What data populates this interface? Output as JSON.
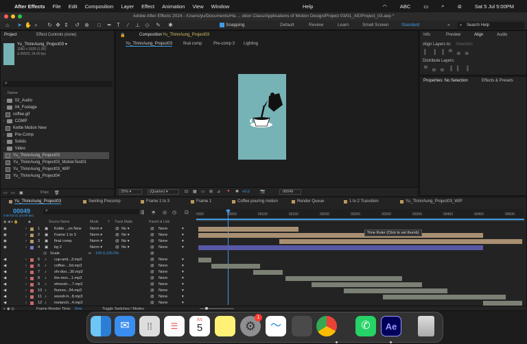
{
  "menubar": {
    "app": "After Effects",
    "items": [
      "File",
      "Edit",
      "Composition",
      "Layer",
      "Effect",
      "Animation",
      "View",
      "Window"
    ],
    "help": "Help",
    "input_source": "ABC",
    "datetime": "Sat 5 Jul  5:00PM"
  },
  "window_title": "Adobe After Effects 2024 - /Users/yu/Documents/Ha ... otion Class/Applications of Motion Design/Project 03/01_AE/Project_03.aep *",
  "toolbar": {
    "snapping": "Snapping",
    "workspaces": [
      "Default",
      "Review",
      "Learn",
      "Small Screen",
      "Standard"
    ],
    "active_workspace": "Standard",
    "search_placeholder": "Search Help"
  },
  "project_panel": {
    "tab_project": "Project",
    "tab_effect_controls": "Effect Controls (none)",
    "comp_name": "Yu_ThinnAung_Project03 ▾",
    "comp_res": "1080 x 1920 (1.00)",
    "comp_dur": "Δ 00520, 24.00 fps",
    "search_icon": "search-icon",
    "col_name": "Name",
    "items": [
      {
        "name": "02_Audio",
        "type": "folder"
      },
      {
        "name": "04_Footage",
        "type": "folder"
      },
      {
        "name": "coffee.gif",
        "type": "file"
      },
      {
        "name": "COMP",
        "type": "folder"
      },
      {
        "name": "Kettle Motion New",
        "type": "comp"
      },
      {
        "name": "Pre-Comp",
        "type": "folder"
      },
      {
        "name": "Solids",
        "type": "folder"
      },
      {
        "name": "Video",
        "type": "folder"
      },
      {
        "name": "Yu_ThinnAung_Project03",
        "type": "comp",
        "selected": true
      },
      {
        "name": "Yu_ThinnAung_Project03_MotionTest01",
        "type": "comp"
      },
      {
        "name": "Yu_ThinnAung_Project03_WIP",
        "type": "comp"
      },
      {
        "name": "Yu_ThinnAung_Project04",
        "type": "comp"
      }
    ],
    "bpc": "8 bpc"
  },
  "comp_panel": {
    "label": "Composition",
    "comp_name": "Yu_ThinnAung_Project03",
    "breadcrumb": [
      "Yu_ThinnAung_Project03",
      "final comp",
      "Pre-comp 3",
      "Lighting"
    ],
    "zoom": "25%",
    "resolution": "(Quarter)",
    "exposure": "+0.0",
    "timecode": "00049",
    "canvas_color": "#76b3b7"
  },
  "right_panel": {
    "tabs": [
      "Info",
      "Preview",
      "Align",
      "Audio"
    ],
    "active": "Align",
    "align_to_label": "Align Layers to:",
    "align_to_value": "Selection",
    "distribute_label": "Distribute Layers:",
    "props_tab": "Properties: No Selection",
    "effects_tab": "Effects & Presets"
  },
  "timeline": {
    "tabs": [
      "Yu_ThinnAung_Project03",
      "Swirling Precomp",
      "Frame 1 to 3",
      "Frame 1",
      "Coffee pouring motion",
      "Render Queue",
      "1 to 2 Transition",
      "Yu_ThinnAung_Project03_WIP"
    ],
    "timecode": "00049",
    "timecode_sub": "0:00:02:01 (24.00 fps)",
    "columns": {
      "source": "Source Name",
      "mode": "Mode",
      "t": "T",
      "trkmat": "Track Matte",
      "parent": "Parent & Link"
    },
    "ruler": [
      "0000",
      "00050",
      "00100",
      "00150",
      "00200",
      "00250",
      "00300",
      "00350",
      "00400",
      "00450",
      "00500"
    ],
    "tooltip": "Time Ruler (Click to set thumb)",
    "layers": [
      {
        "num": "1",
        "name": "Kettle ...on New",
        "mode": "Norm",
        "matte": "No",
        "parent": "None",
        "bar_start": 0,
        "bar_end": 0.31,
        "color": "#a98f72"
      },
      {
        "num": "2",
        "name": "Frame 1 to 3",
        "mode": "Norm",
        "matte": "No",
        "parent": "None",
        "bar_start": 0,
        "bar_end": 0.88,
        "color": "#a98f72"
      },
      {
        "num": "3",
        "name": "final comp",
        "mode": "Norm",
        "matte": "No",
        "parent": "None",
        "bar_start": 0.25,
        "bar_end": 1,
        "color": "#a98f72"
      },
      {
        "num": "4",
        "name": "bg 2",
        "mode": "Norm",
        "matte": "No",
        "parent": "None",
        "bar_start": 0,
        "bar_end": 0.88,
        "color": "#5858a8"
      },
      {
        "num": "5",
        "name": "cup-and...3.mp3",
        "parent": "None",
        "bar_start": 0,
        "bar_end": 0.04,
        "color": "#7a8074"
      },
      {
        "num": "6",
        "name": "coffee-...5d.mp3",
        "parent": "None",
        "bar_start": 0.04,
        "bar_end": 0.19,
        "color": "#7a8074"
      },
      {
        "num": "7",
        "name": "sfx-doo...30.mp3",
        "parent": "None",
        "bar_start": 0.17,
        "bar_end": 0.26,
        "color": "#7a8074"
      },
      {
        "num": "8",
        "name": "the-moc...1.mp3",
        "parent": "None",
        "bar_start": 0.27,
        "bar_end": 0.63,
        "color": "#7a8074"
      },
      {
        "num": "9",
        "name": "whoosh-...7.mp3",
        "parent": "None",
        "bar_start": 0.35,
        "bar_end": 0.69,
        "color": "#7a8074"
      },
      {
        "num": "10",
        "name": "fluores...94.mp3",
        "parent": "None",
        "bar_start": 0.45,
        "bar_end": 0.77,
        "color": "#7a8074"
      },
      {
        "num": "11",
        "name": "woosh-h...8.mp3",
        "parent": "None",
        "bar_start": 0.57,
        "bar_end": 0.95,
        "color": "#7a8074"
      },
      {
        "num": "12",
        "name": "melanch...4.mp3",
        "parent": "None",
        "bar_start": 0.88,
        "bar_end": 1,
        "color": "#7a8074"
      }
    ],
    "scale_label": "Scale",
    "scale_value": "100.0,100.0%",
    "footer_render": "Frame Render Time:",
    "footer_render_val": "0ms",
    "footer_toggle": "Toggle Switches / Modes"
  },
  "dock": {
    "apps": [
      "Finder",
      "Mail",
      "Launchpad",
      "Reminders",
      "Calendar",
      "Notes",
      "System Settings",
      "Freeform",
      "iPhone Mirroring",
      "Chrome",
      "WhatsApp",
      "After Effects",
      "Trash"
    ],
    "calendar_month": "JUL",
    "calendar_day": "5",
    "settings_badge": "1",
    "ae_label": "Ae"
  }
}
